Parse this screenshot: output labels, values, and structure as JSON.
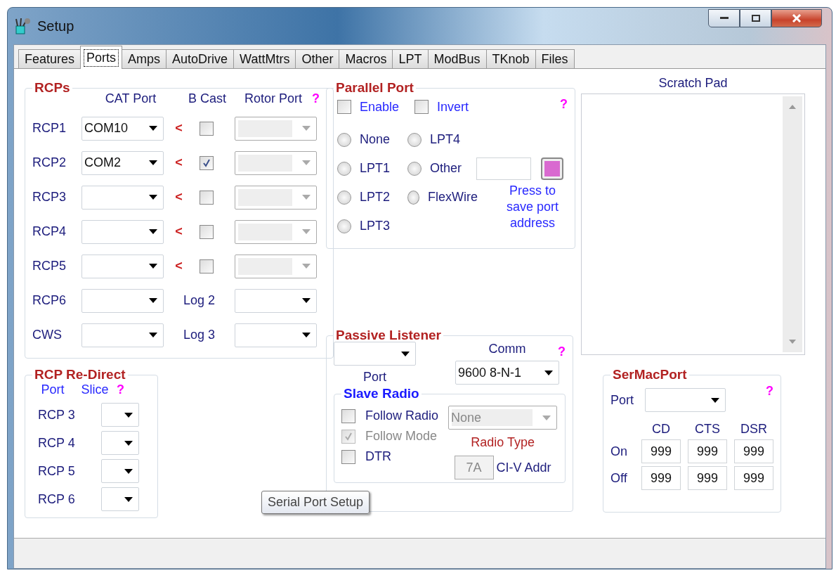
{
  "window": {
    "title": "Setup"
  },
  "tabs": [
    {
      "label": "Features",
      "selected": false
    },
    {
      "label": "Ports",
      "selected": true
    },
    {
      "label": "Amps",
      "selected": false
    },
    {
      "label": "AutoDrive",
      "selected": false
    },
    {
      "label": "WattMtrs",
      "selected": false
    },
    {
      "label": "Other",
      "selected": false
    },
    {
      "label": "Macros",
      "selected": false
    },
    {
      "label": "LPT",
      "selected": false
    },
    {
      "label": "ModBus",
      "selected": false
    },
    {
      "label": "TKnob",
      "selected": false
    },
    {
      "label": "Files",
      "selected": false
    }
  ],
  "rcps": {
    "title": "RCPs",
    "headers": [
      "CAT Port",
      "B Cast",
      "Rotor Port"
    ],
    "help": "?",
    "rows": [
      {
        "kind": "rcp",
        "label": "RCP1",
        "cat_port": "COM10",
        "arrow": "<",
        "bcast": false
      },
      {
        "kind": "rcp",
        "label": "RCP2",
        "cat_port": "COM2",
        "arrow": "<",
        "bcast": true
      },
      {
        "kind": "rcp",
        "label": "RCP3",
        "arrow": "<",
        "bcast": false
      },
      {
        "kind": "rcp",
        "label": "RCP4",
        "arrow": "<",
        "bcast": false
      },
      {
        "kind": "rcp",
        "label": "RCP5",
        "arrow": "<",
        "bcast": false
      },
      {
        "kind": "log",
        "label": "RCP6",
        "log_label": "Log 2"
      },
      {
        "kind": "log",
        "label": "CWS",
        "log_label": "Log 3"
      }
    ]
  },
  "redirect": {
    "title": "RCP Re-Direct",
    "headers": [
      "Port",
      "Slice"
    ],
    "help": "?",
    "rows": [
      "RCP 3",
      "RCP 4",
      "RCP 5",
      "RCP 6"
    ]
  },
  "parallel_port": {
    "title": "Parallel Port",
    "help": "?",
    "checkboxes": [
      {
        "label": "Enable",
        "checked": false
      },
      {
        "label": "Invert",
        "checked": false
      }
    ],
    "radio_columns": [
      [
        {
          "label": "None",
          "selected": false
        },
        {
          "label": "LPT1",
          "selected": false
        },
        {
          "label": "LPT2",
          "selected": false
        },
        {
          "label": "LPT3",
          "selected": false
        }
      ],
      [
        {
          "label": "LPT4",
          "selected": false
        },
        {
          "label": "Other",
          "selected": false
        },
        {
          "label": "FlexWire",
          "selected": false
        }
      ]
    ],
    "save_note": "Press to save port address"
  },
  "passive_listener": {
    "title": "Passive Listener",
    "help": "?",
    "port_label": "Port",
    "comm_label": "Comm",
    "comm_value": "9600 8-N-1",
    "slave_radio": {
      "title": "Slave Radio",
      "options": [
        {
          "label": "Follow Radio",
          "checked": false,
          "disabled": false
        },
        {
          "label": "Follow Mode",
          "checked": true,
          "disabled": true
        },
        {
          "label": "DTR",
          "checked": false,
          "disabled": false
        }
      ],
      "radio_type_value": "None",
      "radio_type_label": "Radio Type",
      "civ_value": "7A",
      "civ_label": "CI-V Addr"
    }
  },
  "scratch_pad": {
    "title": "Scratch Pad"
  },
  "sermacport": {
    "title": "SerMacPort",
    "help": "?",
    "port_label": "Port",
    "columns": [
      "CD",
      "CTS",
      "DSR"
    ],
    "rows": [
      {
        "label": "On",
        "values": [
          "999",
          "999",
          "999"
        ]
      },
      {
        "label": "Off",
        "values": [
          "999",
          "999",
          "999"
        ]
      }
    ]
  },
  "tooltip": {
    "text": "Serial Port Setup"
  }
}
